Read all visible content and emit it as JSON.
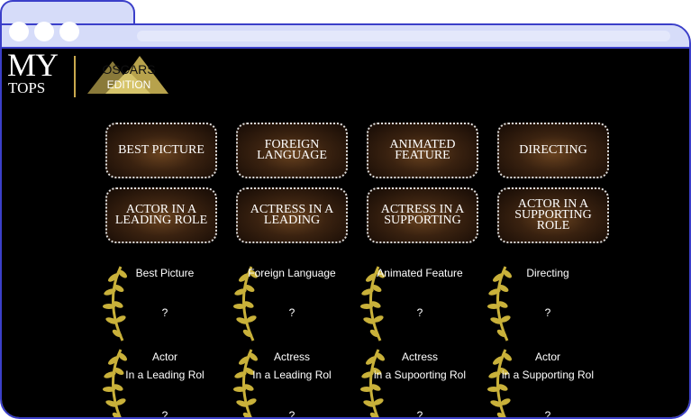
{
  "brand": {
    "my": "MY",
    "tops": "TOPS",
    "badge_top": "OSCARS",
    "badge_bottom": "EDITION"
  },
  "categories": [
    "BEST PICTURE",
    "FOREIGN LANGUAGE",
    "ANIMATED FEATURE",
    "DIRECTING",
    "ACTOR IN A LEADING ROLE",
    "ACTRESS IN A LEADING",
    "ACTRESS IN A SUPPORTING",
    "ACTOR IN A SUPPORTING ROLE"
  ],
  "picks_row1": [
    {
      "title": "Best Picture",
      "value": "?"
    },
    {
      "title": "Foreign Language",
      "value": "?"
    },
    {
      "title": "Animated Feature",
      "value": "?"
    },
    {
      "title": "Directing",
      "value": "?"
    }
  ],
  "picks_row2": [
    {
      "line1": "Actor",
      "line2": "In a Leading Rol",
      "value": "?"
    },
    {
      "line1": "Actress",
      "line2": "In a Leading Rol",
      "value": "?"
    },
    {
      "line1": "Actress",
      "line2": "in a Supoorting Rol",
      "value": "?"
    },
    {
      "line1": "Actor",
      "line2": "in a Supporting Rol",
      "value": "?"
    }
  ],
  "colors": {
    "frame": "#3b3fc9",
    "chrome": "#d6dcf9",
    "gold": "#c9b13a"
  }
}
